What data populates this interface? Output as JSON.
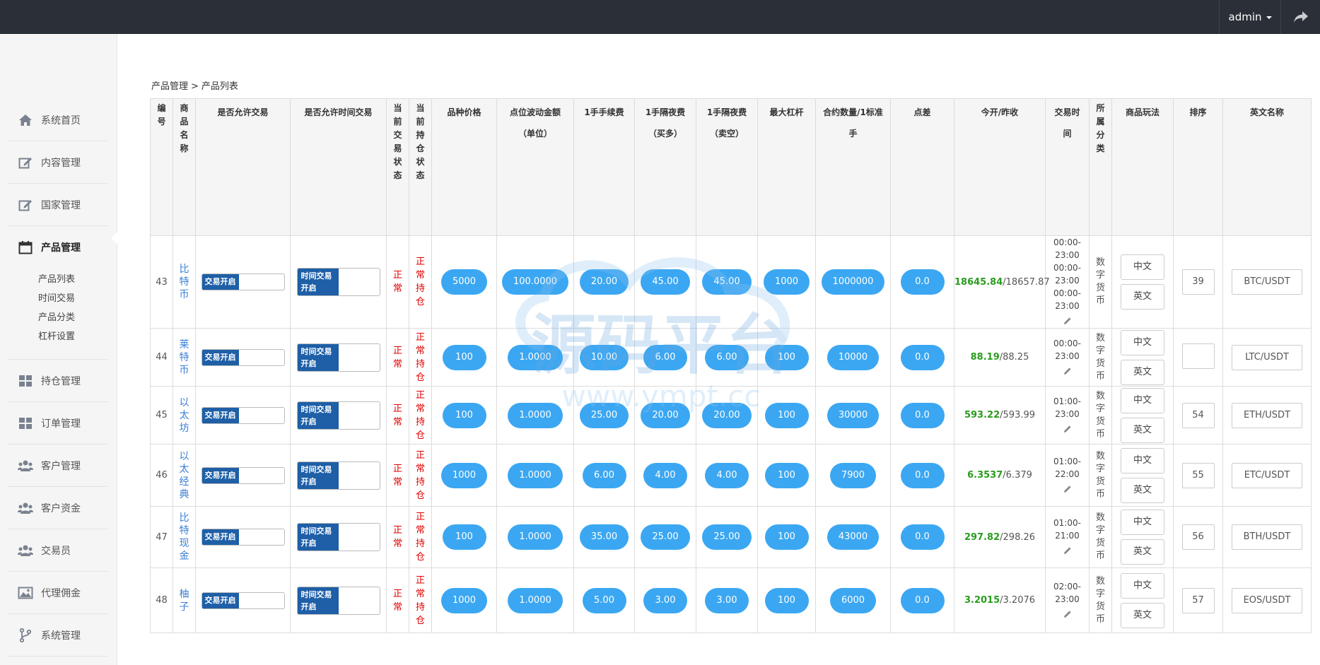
{
  "topbar": {
    "user": "admin"
  },
  "sidebar": {
    "items": [
      {
        "label": "系统首页",
        "icon": "home-icon"
      },
      {
        "label": "内容管理",
        "icon": "edit-icon"
      },
      {
        "label": "国家管理",
        "icon": "edit-icon"
      },
      {
        "label": "产品管理",
        "icon": "calendar-icon"
      },
      {
        "label": "持仓管理",
        "icon": "grid-icon"
      },
      {
        "label": "订单管理",
        "icon": "grid-icon"
      },
      {
        "label": "客户管理",
        "icon": "users-icon"
      },
      {
        "label": "客户资金",
        "icon": "users-icon"
      },
      {
        "label": "交易员",
        "icon": "users-icon"
      },
      {
        "label": "代理佣金",
        "icon": "image-icon"
      },
      {
        "label": "系统管理",
        "icon": "branch-icon"
      }
    ],
    "sub": [
      "产品列表",
      "时间交易",
      "产品分类",
      "杠杆设置"
    ]
  },
  "breadcrumb": {
    "parent": "产品管理",
    "sep": ">",
    "current": "产品列表"
  },
  "table": {
    "headers": [
      "编号",
      "商品名称",
      "是否允许交易",
      "是否允许时间交易",
      "当前交易状态",
      "当前持仓状态",
      "品种价格",
      "点位波动金额（单位）",
      "1手手续费",
      "1手隔夜费（买多）",
      "1手隔夜费（卖空）",
      "最大杠杆",
      "合约数量/1标准手",
      "点差",
      "今开/昨收",
      "交易时间",
      "所属分类",
      "商品玩法",
      "排序",
      "英文名称"
    ],
    "toggle_on": "交易开启",
    "time_toggle_on": "时间交易开启",
    "trade_state": "正常",
    "hold_state": "正常持仓",
    "category": "数字货币",
    "play_cn": "中文",
    "play_en": "英文",
    "rows": [
      {
        "id": "43",
        "name": "比特币",
        "price": "5000",
        "wave": "100.0000",
        "fee": "20.00",
        "buy": "45.00",
        "sell": "45.00",
        "lev": "1000",
        "qty": "1000000",
        "spread": "0.0",
        "open": "18645.84",
        "close": "/18657.87",
        "time": [
          "00:00-",
          "23:00",
          "00:00-",
          "23:00",
          "00:00-",
          "23:00"
        ],
        "sort": "39",
        "en": "BTC/USDT"
      },
      {
        "id": "44",
        "name": "莱特币",
        "price": "100",
        "wave": "1.0000",
        "fee": "10.00",
        "buy": "6.00",
        "sell": "6.00",
        "lev": "100",
        "qty": "10000",
        "spread": "0.0",
        "open": "88.19",
        "close": "/88.25",
        "time": [
          "00:00-",
          "23:00"
        ],
        "sort": "",
        "en": "LTC/USDT"
      },
      {
        "id": "45",
        "name": "以太坊",
        "price": "100",
        "wave": "1.0000",
        "fee": "25.00",
        "buy": "20.00",
        "sell": "20.00",
        "lev": "100",
        "qty": "30000",
        "spread": "0.0",
        "open": "593.22",
        "close": "/593.99",
        "time": [
          "01:00-",
          "23:00"
        ],
        "sort": "54",
        "en": "ETH/USDT"
      },
      {
        "id": "46",
        "name": "以太经典",
        "price": "1000",
        "wave": "1.0000",
        "fee": "6.00",
        "buy": "4.00",
        "sell": "4.00",
        "lev": "100",
        "qty": "7900",
        "spread": "0.0",
        "open": "6.3537",
        "close": "/6.379",
        "time": [
          "01:00-",
          "22:00"
        ],
        "sort": "55",
        "en": "ETC/USDT"
      },
      {
        "id": "47",
        "name": "比特现金",
        "price": "100",
        "wave": "1.0000",
        "fee": "35.00",
        "buy": "25.00",
        "sell": "25.00",
        "lev": "100",
        "qty": "43000",
        "spread": "0.0",
        "open": "297.82",
        "close": "/298.26",
        "time": [
          "01:00-",
          "21:00"
        ],
        "sort": "56",
        "en": "BTH/USDT"
      },
      {
        "id": "48",
        "name": "柚子",
        "price": "1000",
        "wave": "1.0000",
        "fee": "5.00",
        "buy": "3.00",
        "sell": "3.00",
        "lev": "100",
        "qty": "6000",
        "spread": "0.0",
        "open": "3.2015",
        "close": "/3.2076",
        "time": [
          "02:00-",
          "23:00"
        ],
        "sort": "57",
        "en": "EOS/USDT"
      }
    ]
  },
  "watermark": {
    "cn": "源码平台",
    "url": "www.ympt.cc"
  }
}
